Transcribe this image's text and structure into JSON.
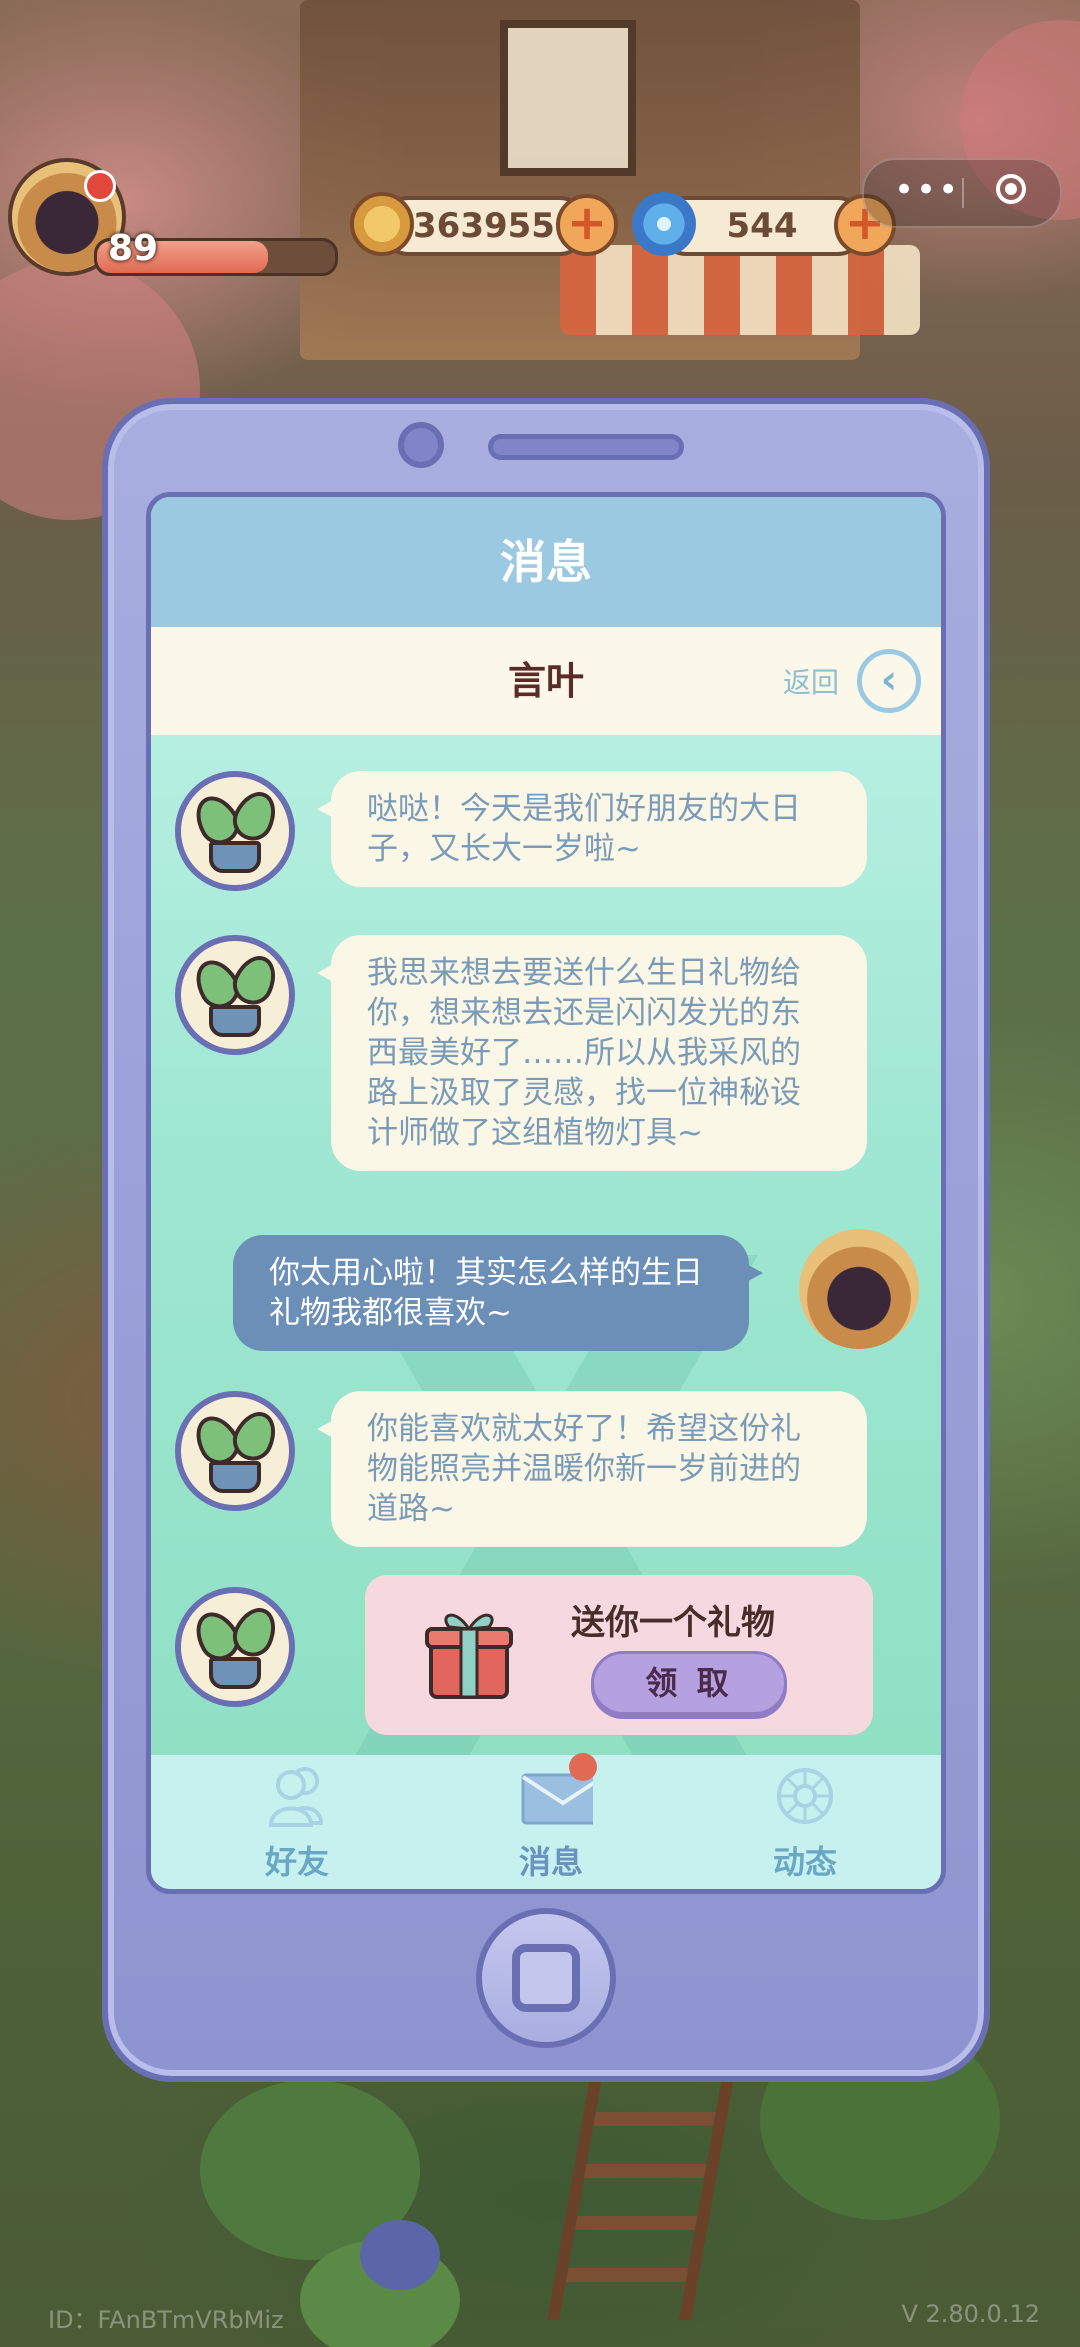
{
  "hud": {
    "level": "89",
    "hp_fraction": 0.72,
    "coins": "363955",
    "gems": "544"
  },
  "screen": {
    "title": "消息",
    "contact_name": "言叶",
    "back_label": "返回"
  },
  "messages": [
    {
      "from": "friend",
      "text": "哒哒！今天是我们好朋友的大日子，又长大一岁啦~"
    },
    {
      "from": "friend",
      "text": "我思来想去要送什么生日礼物给你，想来想去还是闪闪发光的东西最美好了……所以从我采风的路上汲取了灵感，找一位神秘设计师做了这组植物灯具~"
    },
    {
      "from": "me",
      "text": "你太用心啦！其实怎么样的生日礼物我都很喜欢~"
    },
    {
      "from": "friend",
      "text": "你能喜欢就太好了！希望这份礼物能照亮并温暖你新一岁前进的道路~"
    }
  ],
  "gift": {
    "title": "送你一个礼物",
    "claim_label": "领 取"
  },
  "tabs": [
    {
      "label": "好友",
      "icon": "friends-icon"
    },
    {
      "label": "消息",
      "icon": "mail-icon",
      "badge": true
    },
    {
      "label": "动态",
      "icon": "moments-icon"
    }
  ],
  "footer": {
    "id_text": "ID：FAnBTmVRbMiz",
    "version": "V 2.80.0.12"
  }
}
